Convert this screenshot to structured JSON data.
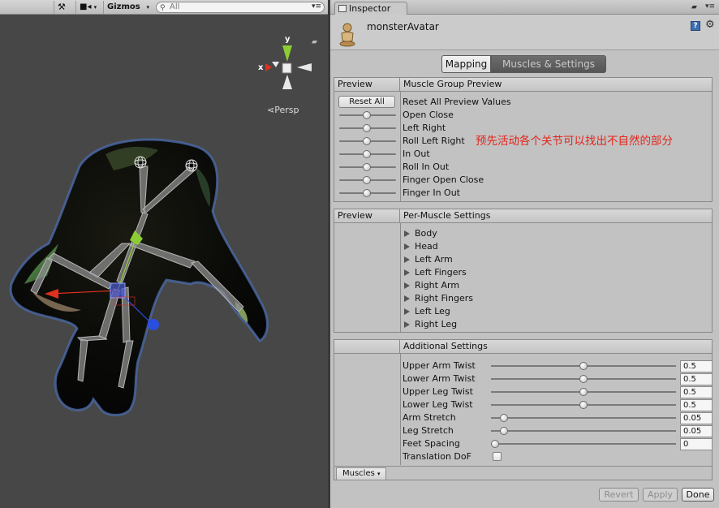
{
  "scene": {
    "toolbar": {
      "tools_icon": "crossed-tools-icon",
      "camera_icon": "video-camera-icon",
      "gizmos_label": "Gizmos",
      "search_placeholder": "All"
    },
    "persp_label": "Persp",
    "gizmo_axes": {
      "x": "x",
      "y": "y"
    }
  },
  "inspector": {
    "tab_label": "Inspector",
    "object_name": "monsterAvatar",
    "mode_tabs": {
      "mapping": "Mapping",
      "muscles": "Muscles & Settings",
      "active": "Muscles & Settings"
    },
    "muscle_group": {
      "head_left": "Preview",
      "head_right": "Muscle Group Preview",
      "reset_button": "Reset All",
      "rows": [
        "Reset All Preview Values",
        "Open Close",
        "Left Right",
        "Roll Left Right",
        "In Out",
        "Roll In Out",
        "Finger Open Close",
        "Finger In Out"
      ]
    },
    "per_muscle": {
      "head_left": "Preview",
      "head_right": "Per-Muscle Settings",
      "items": [
        "Body",
        "Head",
        "Left Arm",
        "Left Fingers",
        "Right Arm",
        "Right Fingers",
        "Left Leg",
        "Right Leg"
      ]
    },
    "additional": {
      "head_right": "Additional Settings",
      "settings": [
        {
          "label": "Upper Arm Twist",
          "value": "0.5",
          "fraction": 0.5
        },
        {
          "label": "Lower Arm Twist",
          "value": "0.5",
          "fraction": 0.5
        },
        {
          "label": "Upper Leg Twist",
          "value": "0.5",
          "fraction": 0.5
        },
        {
          "label": "Lower Leg Twist",
          "value": "0.5",
          "fraction": 0.5
        },
        {
          "label": "Arm Stretch",
          "value": "0.05",
          "fraction": 0.05
        },
        {
          "label": "Leg Stretch",
          "value": "0.05",
          "fraction": 0.05
        },
        {
          "label": "Feet Spacing",
          "value": "0",
          "fraction": 0
        }
      ],
      "translation_dof_label": "Translation DoF",
      "translation_dof_checked": false
    },
    "muscles_dropdown": "Muscles",
    "buttons": {
      "revert": "Revert",
      "apply": "Apply",
      "done": "Done"
    }
  },
  "annotation": "预先活动各个关节可以找出不自然的部分"
}
